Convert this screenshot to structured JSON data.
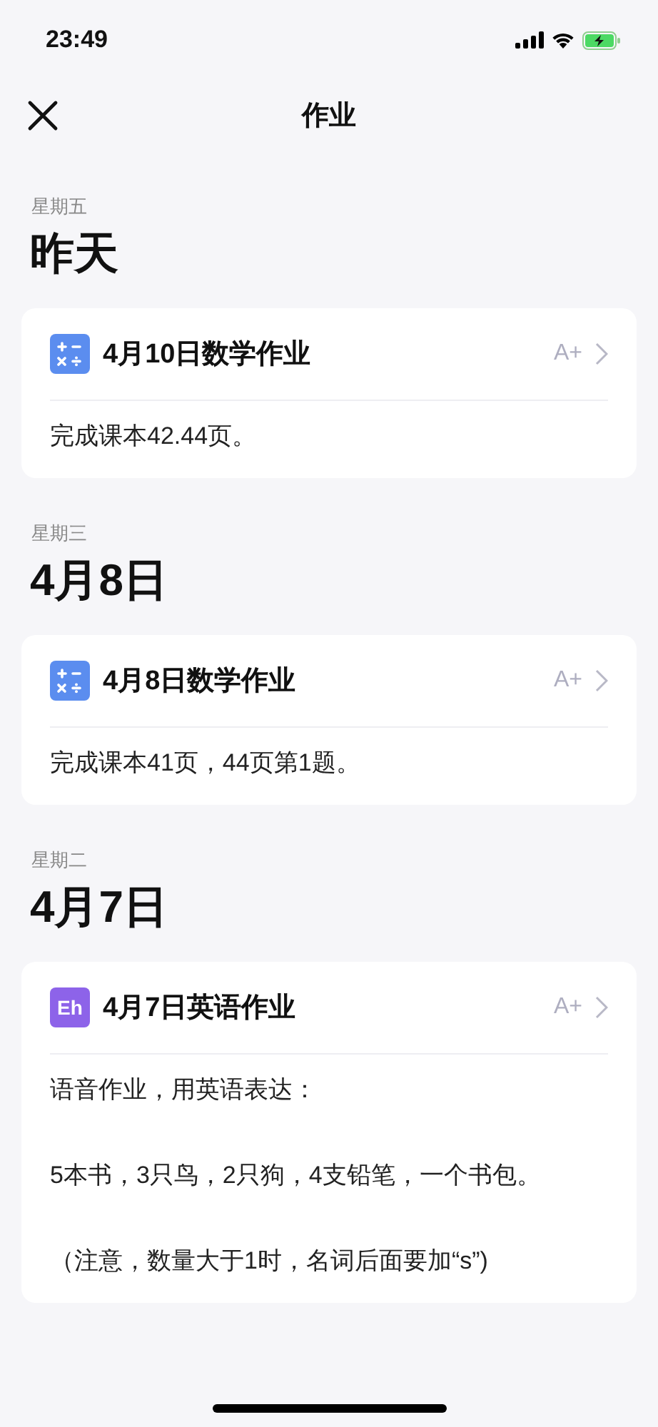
{
  "status_bar": {
    "time": "23:49"
  },
  "nav": {
    "title": "作业"
  },
  "sections": [
    {
      "weekday": "星期五",
      "date": "昨天",
      "cards": [
        {
          "kind": "math",
          "title": "4月10日数学作业",
          "action": "A+",
          "body": [
            "完成课本42.44页。"
          ]
        }
      ]
    },
    {
      "weekday": "星期三",
      "date": "4月8日",
      "cards": [
        {
          "kind": "math",
          "title": "4月8日数学作业",
          "action": "A+",
          "body": [
            "完成课本41页，44页第1题。"
          ]
        }
      ]
    },
    {
      "weekday": "星期二",
      "date": "4月7日",
      "cards": [
        {
          "kind": "english",
          "icon_label": "Eh",
          "title": "4月7日英语作业",
          "action": "A+",
          "body": [
            "语音作业，用英语表达：",
            "5本书，3只鸟，2只狗，4支铅笔，一个书包。",
            "（注意，数量大于1时，名词后面要加“s”)"
          ]
        }
      ]
    }
  ]
}
